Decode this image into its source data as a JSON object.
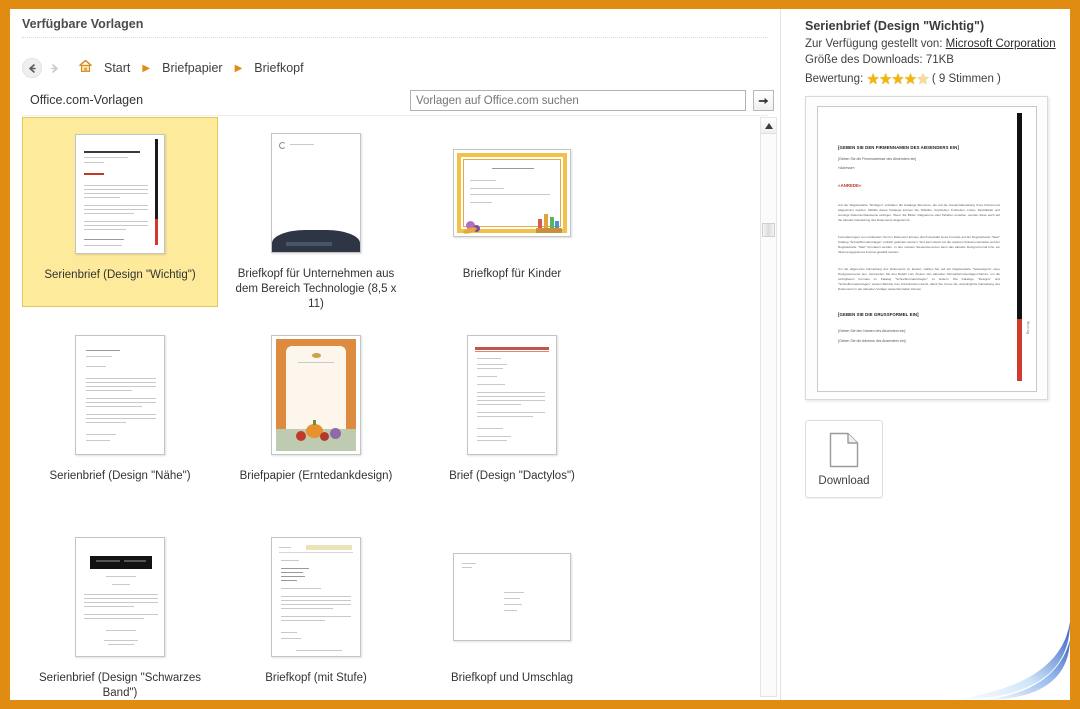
{
  "window": {
    "pane_title": "Verfügbare Vorlagen"
  },
  "breadcrumb": {
    "back_icon": "arrow-left-icon",
    "forward_icon": "arrow-right-icon",
    "home_icon": "home-icon",
    "items": [
      {
        "label": "Start"
      },
      {
        "label": "Briefpapier"
      },
      {
        "label": "Briefkopf"
      }
    ],
    "separator": "▶"
  },
  "source_row": {
    "label": "Office.com-Vorlagen",
    "search_placeholder": "Vorlagen auf Office.com suchen",
    "search_value": "",
    "go_icon": "arrow-right-icon"
  },
  "scrollbar": {
    "up_icon": "triangle-up-icon",
    "down_icon": "triangle-down-icon"
  },
  "templates": [
    {
      "label": "Serienbrief (Design \"Wichtig\")",
      "selected": true,
      "style": "wichtig"
    },
    {
      "label": "Briefkopf für Unternehmen aus dem Bereich Technologie (8,5 x 11)",
      "selected": false,
      "style": "technologie"
    },
    {
      "label": "Briefkopf für Kinder",
      "selected": false,
      "style": "kinder"
    },
    {
      "label": "Serienbrief (Design \"Nähe\")",
      "selected": false,
      "style": "naehe"
    },
    {
      "label": "Briefpapier (Erntedankdesign)",
      "selected": false,
      "style": "erntedank"
    },
    {
      "label": "Brief (Design \"Dactylos\")",
      "selected": false,
      "style": "dactylos"
    },
    {
      "label": "Serienbrief (Design \"Schwarzes Band\")",
      "selected": false,
      "style": "schwarzesband"
    },
    {
      "label": "Briefkopf (mit Stufe)",
      "selected": false,
      "style": "stufe"
    },
    {
      "label": "Briefkopf und Umschlag",
      "selected": false,
      "style": "umschlag"
    }
  ],
  "details": {
    "title": "Serienbrief (Design \"Wichtig\")",
    "provider_label": "Zur Verfügung gestellt von:",
    "provider_value": "Microsoft Corporation",
    "size_label": "Größe des Downloads:",
    "size_value": "71KB",
    "rating_label": "Bewertung:",
    "rating_stars": 4.5,
    "rating_votes": "( 9 Stimmen )",
    "download_label": "Download",
    "download_icon": "document-icon"
  },
  "preview": {
    "heading": "[GEBEN SIE DEN FIRMENNAMEN DES ABSENDERS EIN]",
    "subline1": "[Geben Sie die Firmenadresse des Absenders ein]",
    "subline2": "»Adresse«",
    "red_heading": "»ANREDE«",
    "paragraph1": "Auf der Registerkarte \"Einfügen\" enthalten die Kataloge Elemente, die auf die Gesamtdarstellung Ihres Dokuments abgestimmt werden. Mithilfe dieser Kataloge können Sie Tabellen, Kopfzeilen, Fußzeilen, Listen, Deckblätter und sonstige Dokumentbausteine einfügen. Wenn Sie Bilder, Diagramme oder Tabellen erstellen, werden diese auch auf die aktuelle Darstellung des Dokuments abgestimmt.",
    "paragraph2": "Formatierungen von markiertem Text im Dokument können durch Auswahl eines Formats auf der Registerkarte \"Start\" Katalog \"Schnellformatvorlagen\" einfach geändert werden. Text kann damit mit der anderen Dokumententeilen auf der Registerkarte \"Start\" formatiert werden. In den meisten Steuerelementen kann das aktuelle Design-Format bzw. ein direkt angegebenes Format gewählt werden.",
    "paragraph3": "Um die allgemeine Darstellung des Dokuments zu ändern, wählen Sie auf der Registerkarte \"Seitenlayout\" neue Designelemente aus. Verwenden Sie den Befehl zum Ändern des aktuellen Schnellformatvorlagen-Satzes, um die verfügbaren Formate im Katalog \"Schnellformatvorlagen\" zu ändern. Die Kataloge \"Designs\" und \"Schnellformatvorlagen\" weisen Befehle zum Zurücksetzen damit, damit Sie immer die ursprüngliche Darstellung des Dokuments in der aktuellen Vorlage wiederherstellen können.",
    "closing": "[GEBEN SIE DIE GRUSSFORMEL EIN]",
    "sender_name": "[Geben Sie den Namen des Absenders ein]",
    "sender_addr": "[Geben Sie die Adresse des Absenders ein]",
    "side_text": "Wichtig"
  },
  "colors": {
    "frame_orange": "#E08B12",
    "selection_yellow": "#FDEA9B",
    "selection_border": "#E8C55A",
    "accent_red": "#C0392B",
    "star_gold": "#F2B705",
    "swoosh_blue": "#2B5BC4"
  }
}
